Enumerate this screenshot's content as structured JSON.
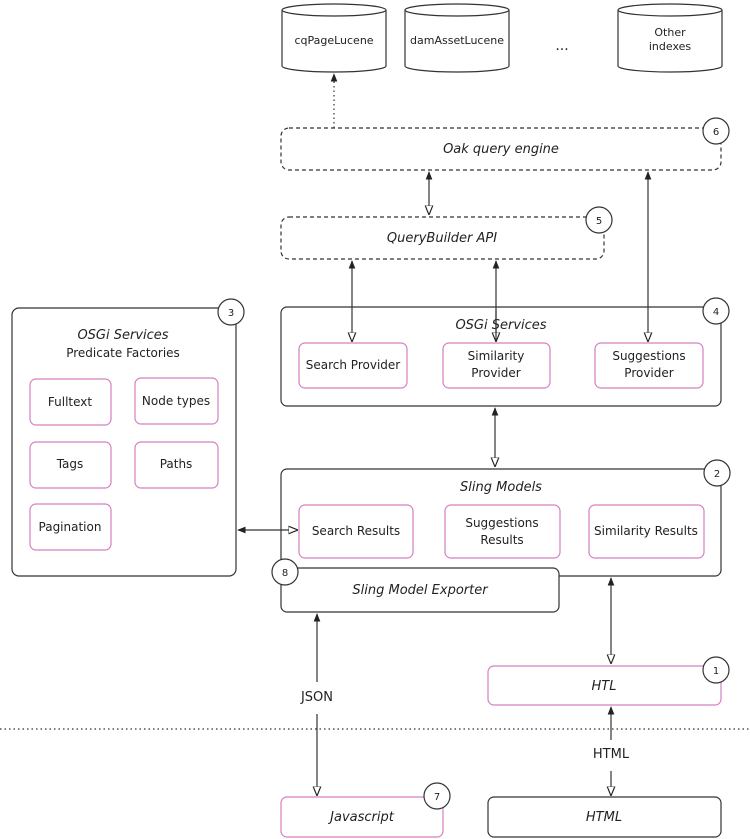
{
  "colors": {
    "stroke": "#333333",
    "pink": "#d77fc0",
    "background": "#ffffff"
  },
  "indexes": [
    {
      "label": [
        "cqPageLucene"
      ]
    },
    {
      "label": [
        "damAssetLucene"
      ]
    },
    {
      "label": [
        "Other",
        "indexes"
      ]
    }
  ],
  "ellipsis": "...",
  "oak": {
    "title": "Oak query engine",
    "number": "6"
  },
  "querybuilder": {
    "title": "QueryBuilder API",
    "number": "5"
  },
  "osgi_providers": {
    "title": "OSGi Services",
    "number": "4",
    "items": [
      {
        "label": [
          "Search Provider"
        ]
      },
      {
        "label": [
          "Similarity",
          "Provider"
        ]
      },
      {
        "label": [
          "Suggestions",
          "Provider"
        ]
      }
    ]
  },
  "osgi_predicates": {
    "title": "OSGi Services",
    "subtitle": "Predicate Factories",
    "number": "3",
    "items": [
      {
        "label": "Fulltext"
      },
      {
        "label": "Node types"
      },
      {
        "label": "Tags"
      },
      {
        "label": "Paths"
      },
      {
        "label": "Pagination"
      }
    ]
  },
  "sling_models": {
    "title": "Sling Models",
    "number": "2",
    "items": [
      {
        "label": [
          "Search Results"
        ]
      },
      {
        "label": [
          "Suggestions",
          "Results"
        ]
      },
      {
        "label": [
          "Similarity Results"
        ]
      }
    ]
  },
  "exporter": {
    "title": "Sling Model Exporter",
    "number": "8"
  },
  "htl": {
    "title": "HTL",
    "number": "1"
  },
  "javascript": {
    "title": "Javascript",
    "number": "7"
  },
  "html_box": {
    "title": "HTML"
  },
  "edge_labels": {
    "json": "JSON",
    "html": "HTML"
  }
}
